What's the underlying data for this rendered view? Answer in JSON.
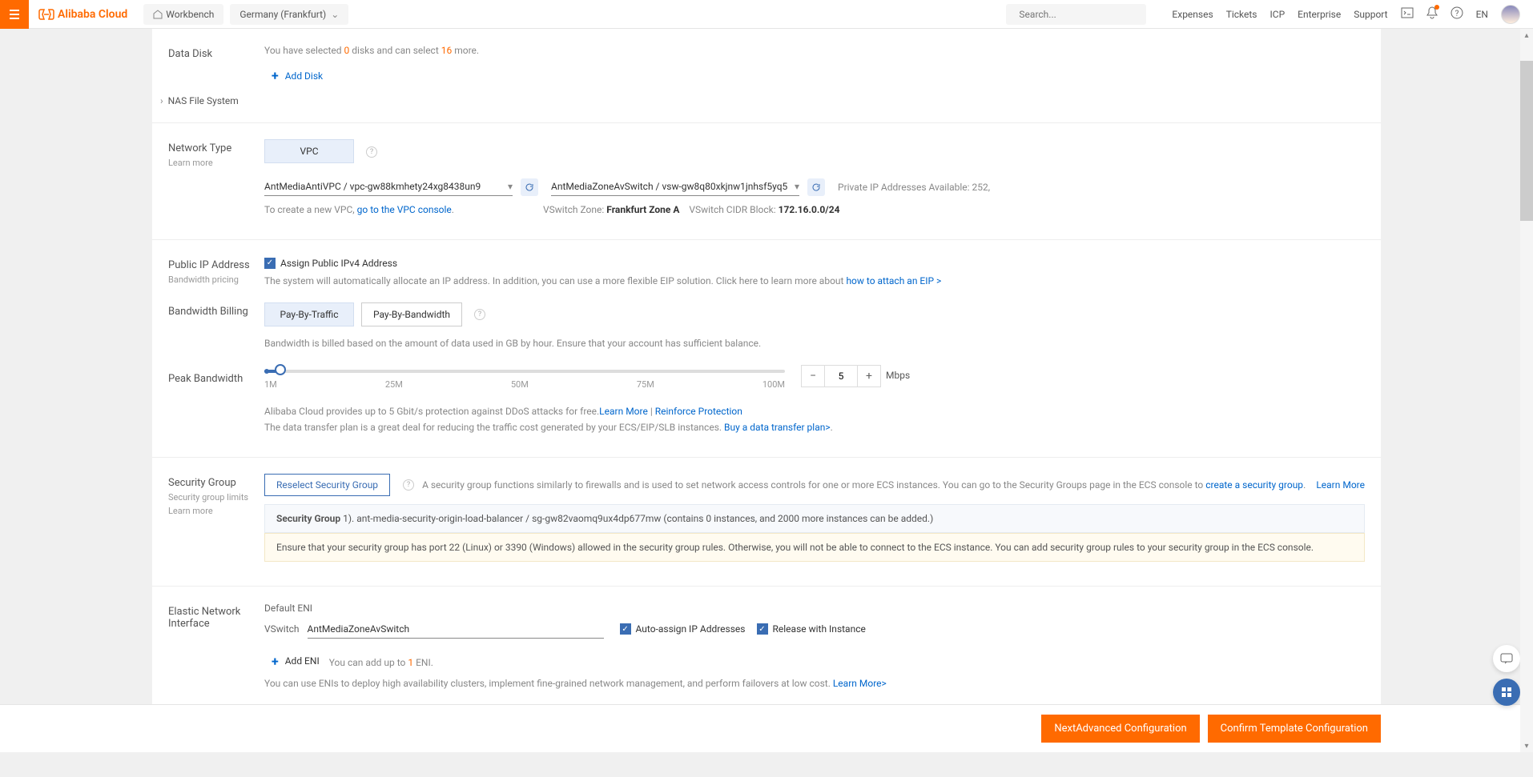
{
  "header": {
    "brand": "Alibaba Cloud",
    "workbench": "Workbench",
    "region": "Germany (Frankfurt)",
    "search_placeholder": "Search...",
    "links": [
      "Expenses",
      "Tickets",
      "ICP",
      "Enterprise",
      "Support"
    ],
    "lang": "EN"
  },
  "dataDisk": {
    "label": "Data Disk",
    "pre": "You have selected ",
    "count": "0",
    "mid": " disks and can select ",
    "remain": "16",
    "post": " more.",
    "add": "Add Disk"
  },
  "nas": {
    "label": "NAS File System"
  },
  "network": {
    "label": "Network Type",
    "learn": "Learn more",
    "vpc_btn": "VPC",
    "vpc_sel": "AntMediaAntiVPC / vpc-gw88kmhety24xg8438un9",
    "vswitch_sel": "AntMediaZoneAvSwitch / vsw-gw8q80xkjnw1jnhsf5yq5",
    "priv_ip_lbl": "Private IP Addresses Available: ",
    "priv_ip_val": "252,",
    "create_pre": "To create a new VPC, ",
    "create_link": "go to the VPC console",
    "zone_lbl": "VSwitch Zone: ",
    "zone_val": "Frankfurt Zone A",
    "cidr_lbl": "VSwitch CIDR Block: ",
    "cidr_val": "172.16.0.0/24"
  },
  "publicIp": {
    "label": "Public IP Address",
    "sub": "Bandwidth pricing",
    "cb": "Assign Public IPv4 Address",
    "desc_pre": "The system will automatically allocate an IP address. In addition, you can use a more flexible EIP solution. Click here to learn more about ",
    "desc_link": "how to attach an EIP >"
  },
  "bwBilling": {
    "label": "Bandwidth Billing",
    "opt1": "Pay-By-Traffic",
    "opt2": "Pay-By-Bandwidth",
    "note": "Bandwidth is billed based on the amount of data used in GB by hour. Ensure that your account has sufficient balance."
  },
  "peak": {
    "label": "Peak Bandwidth",
    "ticks": [
      "1M",
      "25M",
      "50M",
      "75M",
      "100M"
    ],
    "value": "5",
    "unit": "Mbps",
    "ddos_pre": "Alibaba Cloud provides up to 5 Gbit/s protection against DDoS attacks for free.",
    "learn": "Learn More",
    "sep": " | ",
    "reinf": "Reinforce Protection",
    "plan_pre": "The data transfer plan is a great deal for reducing the traffic cost generated by your ECS/EIP/SLB instances. ",
    "plan_link": "Buy a data transfer plan>"
  },
  "sg": {
    "label": "Security Group",
    "sub1": "Security group limits",
    "sub2": "Learn more",
    "reselect": "Reselect Security Group",
    "desc_pre": "A security group functions similarly to firewalls and is used to set network access controls for one or more ECS instances. You can go to the Security Groups page in the ECS console to ",
    "desc_link": "create a security group",
    "learn": "Learn More",
    "selected_lbl": "Security Group ",
    "selected_val": "1). ant-media-security-origin-load-balancer / sg-gw82vaomq9ux4dp677mw (contains 0 instances, and 2000 more instances can be added.)",
    "warn": "Ensure that your security group has port 22 (Linux) or 3390 (Windows) allowed in the security group rules. Otherwise, you will not be able to connect to the ECS instance. You can add security group rules to your security group in the ECS console."
  },
  "eni": {
    "label1": "Elastic Network",
    "label2": "Interface",
    "default": "Default ENI",
    "vswitch_lbl": "VSwitch",
    "vswitch_val": "AntMediaZoneAvSwitch",
    "auto": "Auto-assign IP Addresses",
    "release": "Release with Instance",
    "add": "Add ENI",
    "add_desc_pre": " You can add up to ",
    "add_desc_n": "1",
    "add_desc_post": " ENI.",
    "note_pre": "You can use ENIs to deploy high availability clusters, implement fine-grained network management, and perform failovers at low cost. ",
    "note_link": "Learn More>"
  },
  "footer": {
    "next": "NextAdvanced Configuration",
    "confirm": "Confirm Template Configuration"
  }
}
